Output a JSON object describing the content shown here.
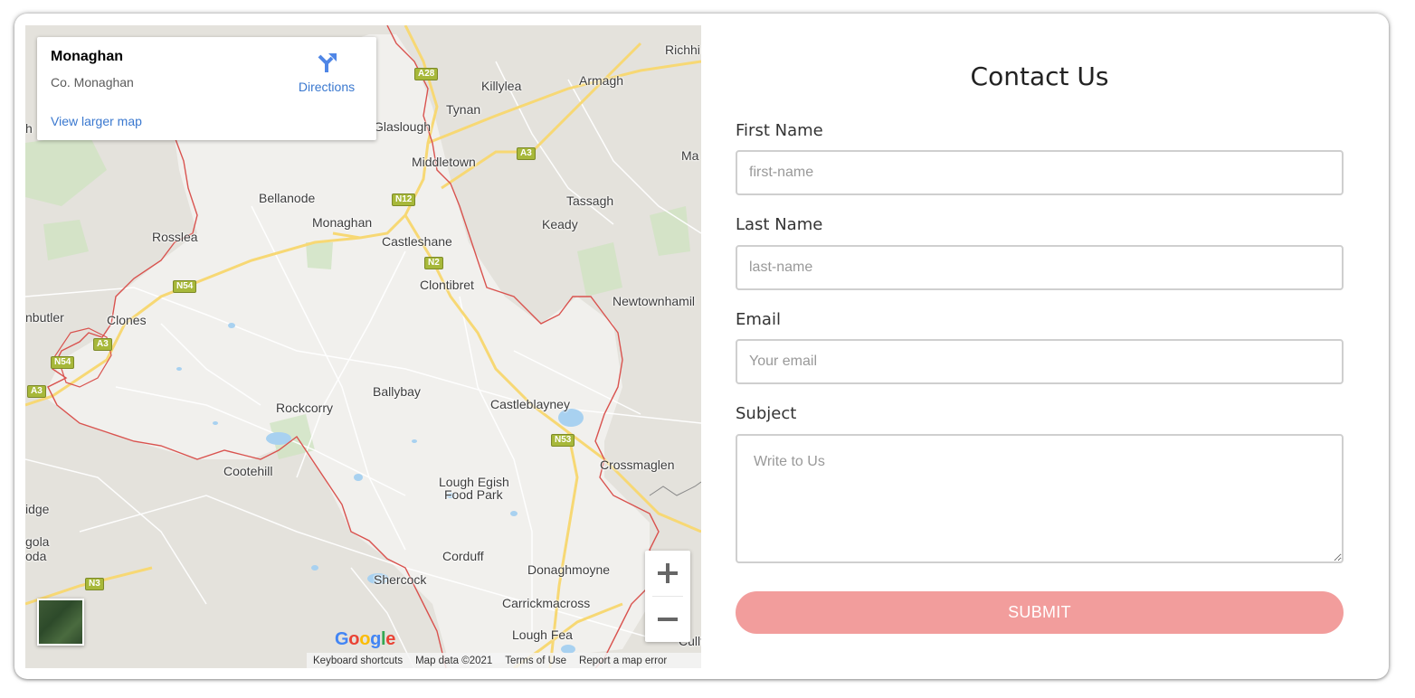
{
  "map": {
    "infobox": {
      "title": "Monaghan",
      "subtitle": "Co. Monaghan",
      "larger_map_link": "View larger map",
      "directions_label": "Directions"
    },
    "places": {
      "richhill": "Richhi",
      "killylea": "Killylea",
      "armagh": "Armagh",
      "glaslough": "Glaslough",
      "tynan": "Tynan",
      "middletown": "Middletown",
      "ma": "Ma",
      "bellanode": "Bellanode",
      "monaghan": "Monaghan",
      "tassagh": "Tassagh",
      "keady": "Keady",
      "castleshane": "Castleshane",
      "rosslea": "Rosslea",
      "clontibret": "Clontibret",
      "newtownhamilton": "Newtownhamil",
      "newtownbutler": "nbutler",
      "clones": "Clones",
      "ballybay": "Ballybay",
      "rockcorry": "Rockcorry",
      "castleblayney": "Castleblayney",
      "cootehill": "Cootehill",
      "crossmaglen": "Crossmaglen",
      "lough_egish": "Lough Egish",
      "food_park": "Food Park",
      "ridge": "idge",
      "gola": "gola",
      "oda": "oda",
      "corduff": "Corduff",
      "donaghmoyne": "Donaghmoyne",
      "shercock": "Shercock",
      "carrickmacross": "Carrickmacross",
      "lough_fea": "Lough Fea",
      "culloville": "Cullt Nl",
      "h_edge": "h"
    },
    "roads": {
      "a28": "A28",
      "a3_top": "A3",
      "n12": "N12",
      "n2": "N2",
      "n54_mid": "N54",
      "a3_clones": "A3",
      "n54_west": "N54",
      "a3_west": "A3",
      "n53": "N53",
      "n3": "N3"
    },
    "google_logo": "Google",
    "attribution": {
      "keyboard": "Keyboard shortcuts",
      "map_data": "Map data ©2021",
      "terms": "Terms of Use",
      "report": "Report a map error"
    }
  },
  "form": {
    "title": "Contact Us",
    "first_name": {
      "label": "First Name",
      "placeholder": "first-name"
    },
    "last_name": {
      "label": "Last Name",
      "placeholder": "last-name"
    },
    "email": {
      "label": "Email",
      "placeholder": "Your email"
    },
    "subject": {
      "label": "Subject",
      "placeholder": "Write to Us"
    },
    "submit_label": "SUBMIT"
  },
  "colors": {
    "submit_bg": "#f29d9c",
    "link_blue": "#3a78cf",
    "border_red": "#d9534f"
  }
}
